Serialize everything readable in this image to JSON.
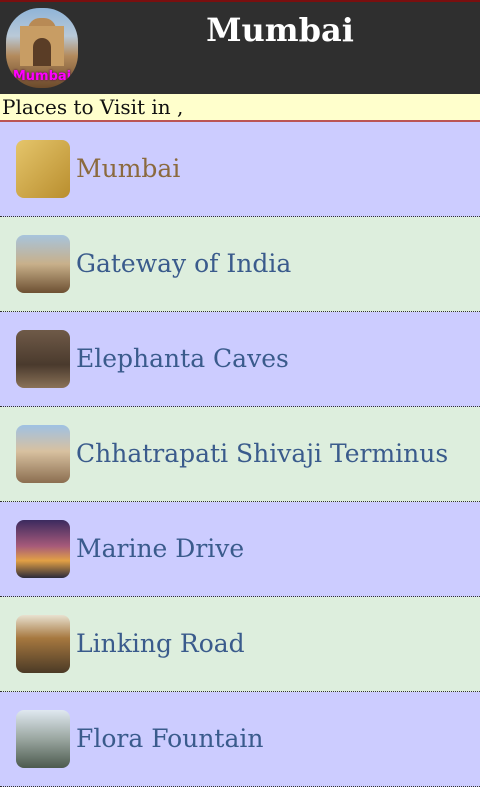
{
  "header": {
    "title": "Mumbai",
    "logo_text": "Mumbai"
  },
  "subheader": {
    "text": "Places to Visit in ,"
  },
  "places": [
    {
      "label": "Mumbai",
      "icon": "mumbai-thumbnail"
    },
    {
      "label": "Gateway of India",
      "icon": "gateway-of-india-thumbnail"
    },
    {
      "label": "Elephanta Caves",
      "icon": "elephanta-caves-thumbnail"
    },
    {
      "label": "Chhatrapati Shivaji Terminus",
      "icon": "chhatrapati-shivaji-terminus-thumbnail"
    },
    {
      "label": "Marine Drive",
      "icon": "marine-drive-thumbnail"
    },
    {
      "label": "Linking Road",
      "icon": "linking-road-thumbnail"
    },
    {
      "label": "Flora Fountain",
      "icon": "flora-fountain-thumbnail"
    }
  ],
  "colors": {
    "header_bg": "#2f2f2f",
    "subheader_bg": "#ffffcc",
    "row_odd_bg": "#ccccff",
    "row_even_bg": "#ddeedd",
    "label_color": "#3a5b8c",
    "first_label_color": "#8b6a3e"
  }
}
